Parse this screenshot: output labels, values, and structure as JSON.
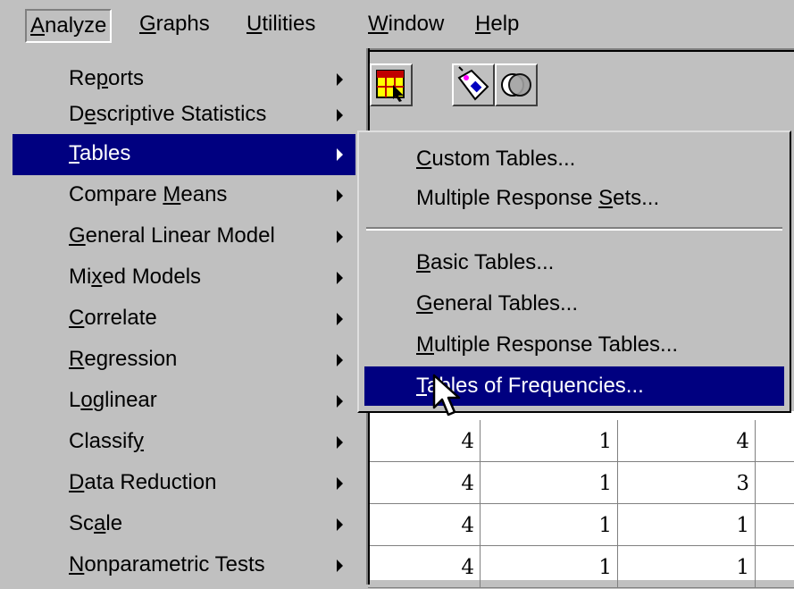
{
  "menubar": {
    "items": [
      {
        "pre": "",
        "u": "A",
        "post": "nalyze"
      },
      {
        "pre": "",
        "u": "G",
        "post": "raphs"
      },
      {
        "pre": "",
        "u": "U",
        "post": "tilities"
      },
      {
        "pre": "",
        "u": "W",
        "post": "indow"
      },
      {
        "pre": "",
        "u": "H",
        "post": "elp"
      }
    ]
  },
  "analyze_menu": {
    "items": [
      {
        "pre": "Re",
        "u": "p",
        "post": "orts"
      },
      {
        "pre": "D",
        "u": "e",
        "post": "scriptive Statistics"
      },
      {
        "pre": "",
        "u": "T",
        "post": "ables"
      },
      {
        "pre": "Compare ",
        "u": "M",
        "post": "eans"
      },
      {
        "pre": "",
        "u": "G",
        "post": "eneral Linear Model"
      },
      {
        "pre": "Mi",
        "u": "x",
        "post": "ed Models"
      },
      {
        "pre": "",
        "u": "C",
        "post": "orrelate"
      },
      {
        "pre": "",
        "u": "R",
        "post": "egression"
      },
      {
        "pre": "L",
        "u": "o",
        "post": "glinear"
      },
      {
        "pre": "Classif",
        "u": "y",
        "post": ""
      },
      {
        "pre": "",
        "u": "D",
        "post": "ata Reduction"
      },
      {
        "pre": "Sc",
        "u": "a",
        "post": "le"
      },
      {
        "pre": "",
        "u": "N",
        "post": "onparametric Tests"
      }
    ],
    "highlighted": "Tables"
  },
  "tables_submenu": {
    "items": [
      {
        "pre": "",
        "u": "C",
        "post": "ustom Tables..."
      },
      {
        "pre": "Multiple Response ",
        "u": "S",
        "post": "ets..."
      },
      {
        "pre": "",
        "u": "B",
        "post": "asic Tables..."
      },
      {
        "pre": "",
        "u": "G",
        "post": "eneral Tables..."
      },
      {
        "pre": "",
        "u": "M",
        "post": "ultiple Response Tables..."
      },
      {
        "pre": "",
        "u": "T",
        "post": "ables of Frequencies..."
      }
    ],
    "highlighted": "Tables of Frequencies..."
  },
  "grid": {
    "rows": [
      [
        "4",
        "1",
        "4"
      ],
      [
        "4",
        "1",
        "3"
      ],
      [
        "4",
        "1",
        "1"
      ],
      [
        "4",
        "1",
        "1"
      ]
    ]
  },
  "colors": {
    "highlight": "#000080",
    "face": "#c0c0c0"
  },
  "icons": [
    "data-editor-icon",
    "value-labels-icon",
    "use-sets-icon"
  ]
}
